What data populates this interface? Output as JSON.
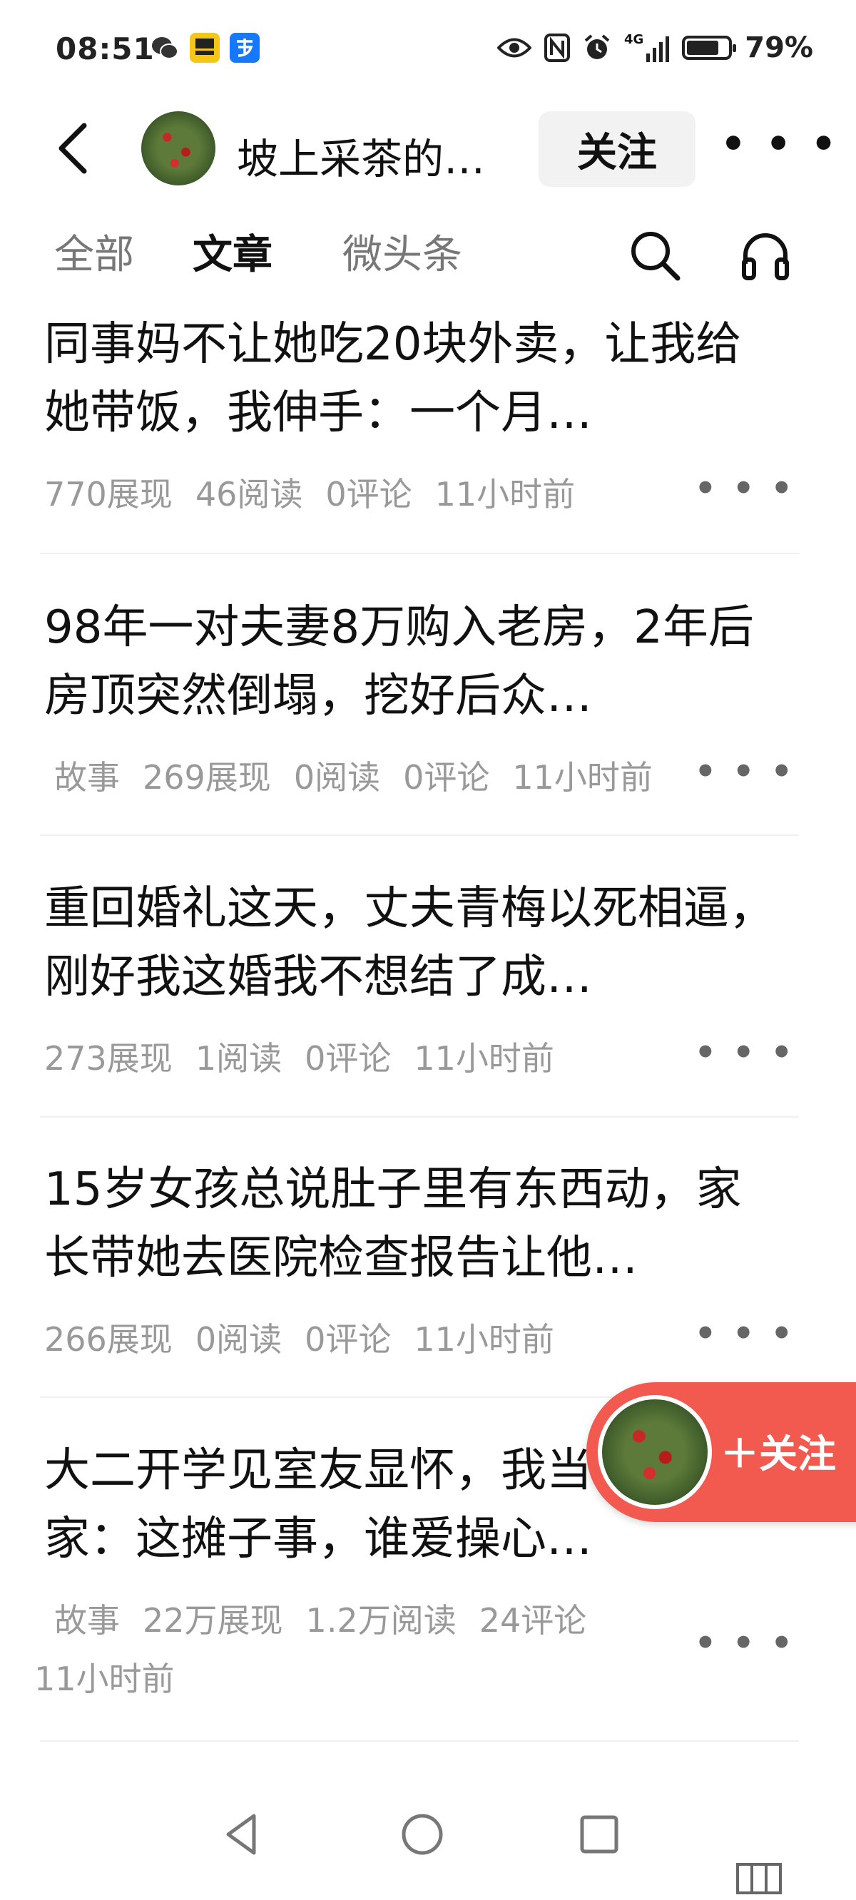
{
  "status_bar": {
    "time": "08:51",
    "icons": [
      "wechat-icon",
      "jrtt-finance-icon",
      "alipay-icon"
    ],
    "right_icons": [
      "eye-icon",
      "nfc-icon",
      "alarm-icon",
      "4g-signal-icon",
      "battery-icon"
    ],
    "network": "4G",
    "battery_percent": "79%",
    "battery_level": 0.79
  },
  "header": {
    "title": "坡上采茶的行…",
    "follow_label": "关注",
    "more_label": "• • •"
  },
  "tabs": [
    {
      "label": "全部",
      "active": false
    },
    {
      "label": "文章",
      "active": true
    },
    {
      "label": "微头条",
      "active": false
    }
  ],
  "articles": [
    {
      "title": "同事妈不让她吃20块外卖，让我给她带饭，我伸手：一个月…",
      "tag": "",
      "stats": [
        "770展现",
        "46阅读",
        "0评论",
        "11小时前"
      ]
    },
    {
      "title": "98年一对夫妻8万购入老房，2年后房顶突然倒塌，挖好后众…",
      "tag": "故事",
      "stats": [
        "269展现",
        "0阅读",
        "0评论",
        "11小时前"
      ]
    },
    {
      "title": "重回婚礼这天，丈夫青梅以死相逼，刚好我这婚我不想结了成…",
      "tag": "",
      "stats": [
        "273展现",
        "1阅读",
        "0评论",
        "11小时前"
      ]
    },
    {
      "title": "15岁女孩总说肚子里有东西动，家长带她去医院检查报告让他…",
      "tag": "",
      "stats": [
        "266展现",
        "0阅读",
        "0评论",
        "11小时前"
      ]
    },
    {
      "title": "大二开学见室友显怀，我当即退宿回家：这摊子事，谁爱操心…",
      "tag": "故事",
      "stats": [
        "22万展现",
        "1.2万阅读",
        "24评论",
        "11小时前"
      ]
    }
  ],
  "article_more_label": "• • •",
  "floating_follow": {
    "label": "＋关注"
  },
  "nav": [
    "back-triangle-icon",
    "home-circle-icon",
    "recents-square-icon"
  ]
}
